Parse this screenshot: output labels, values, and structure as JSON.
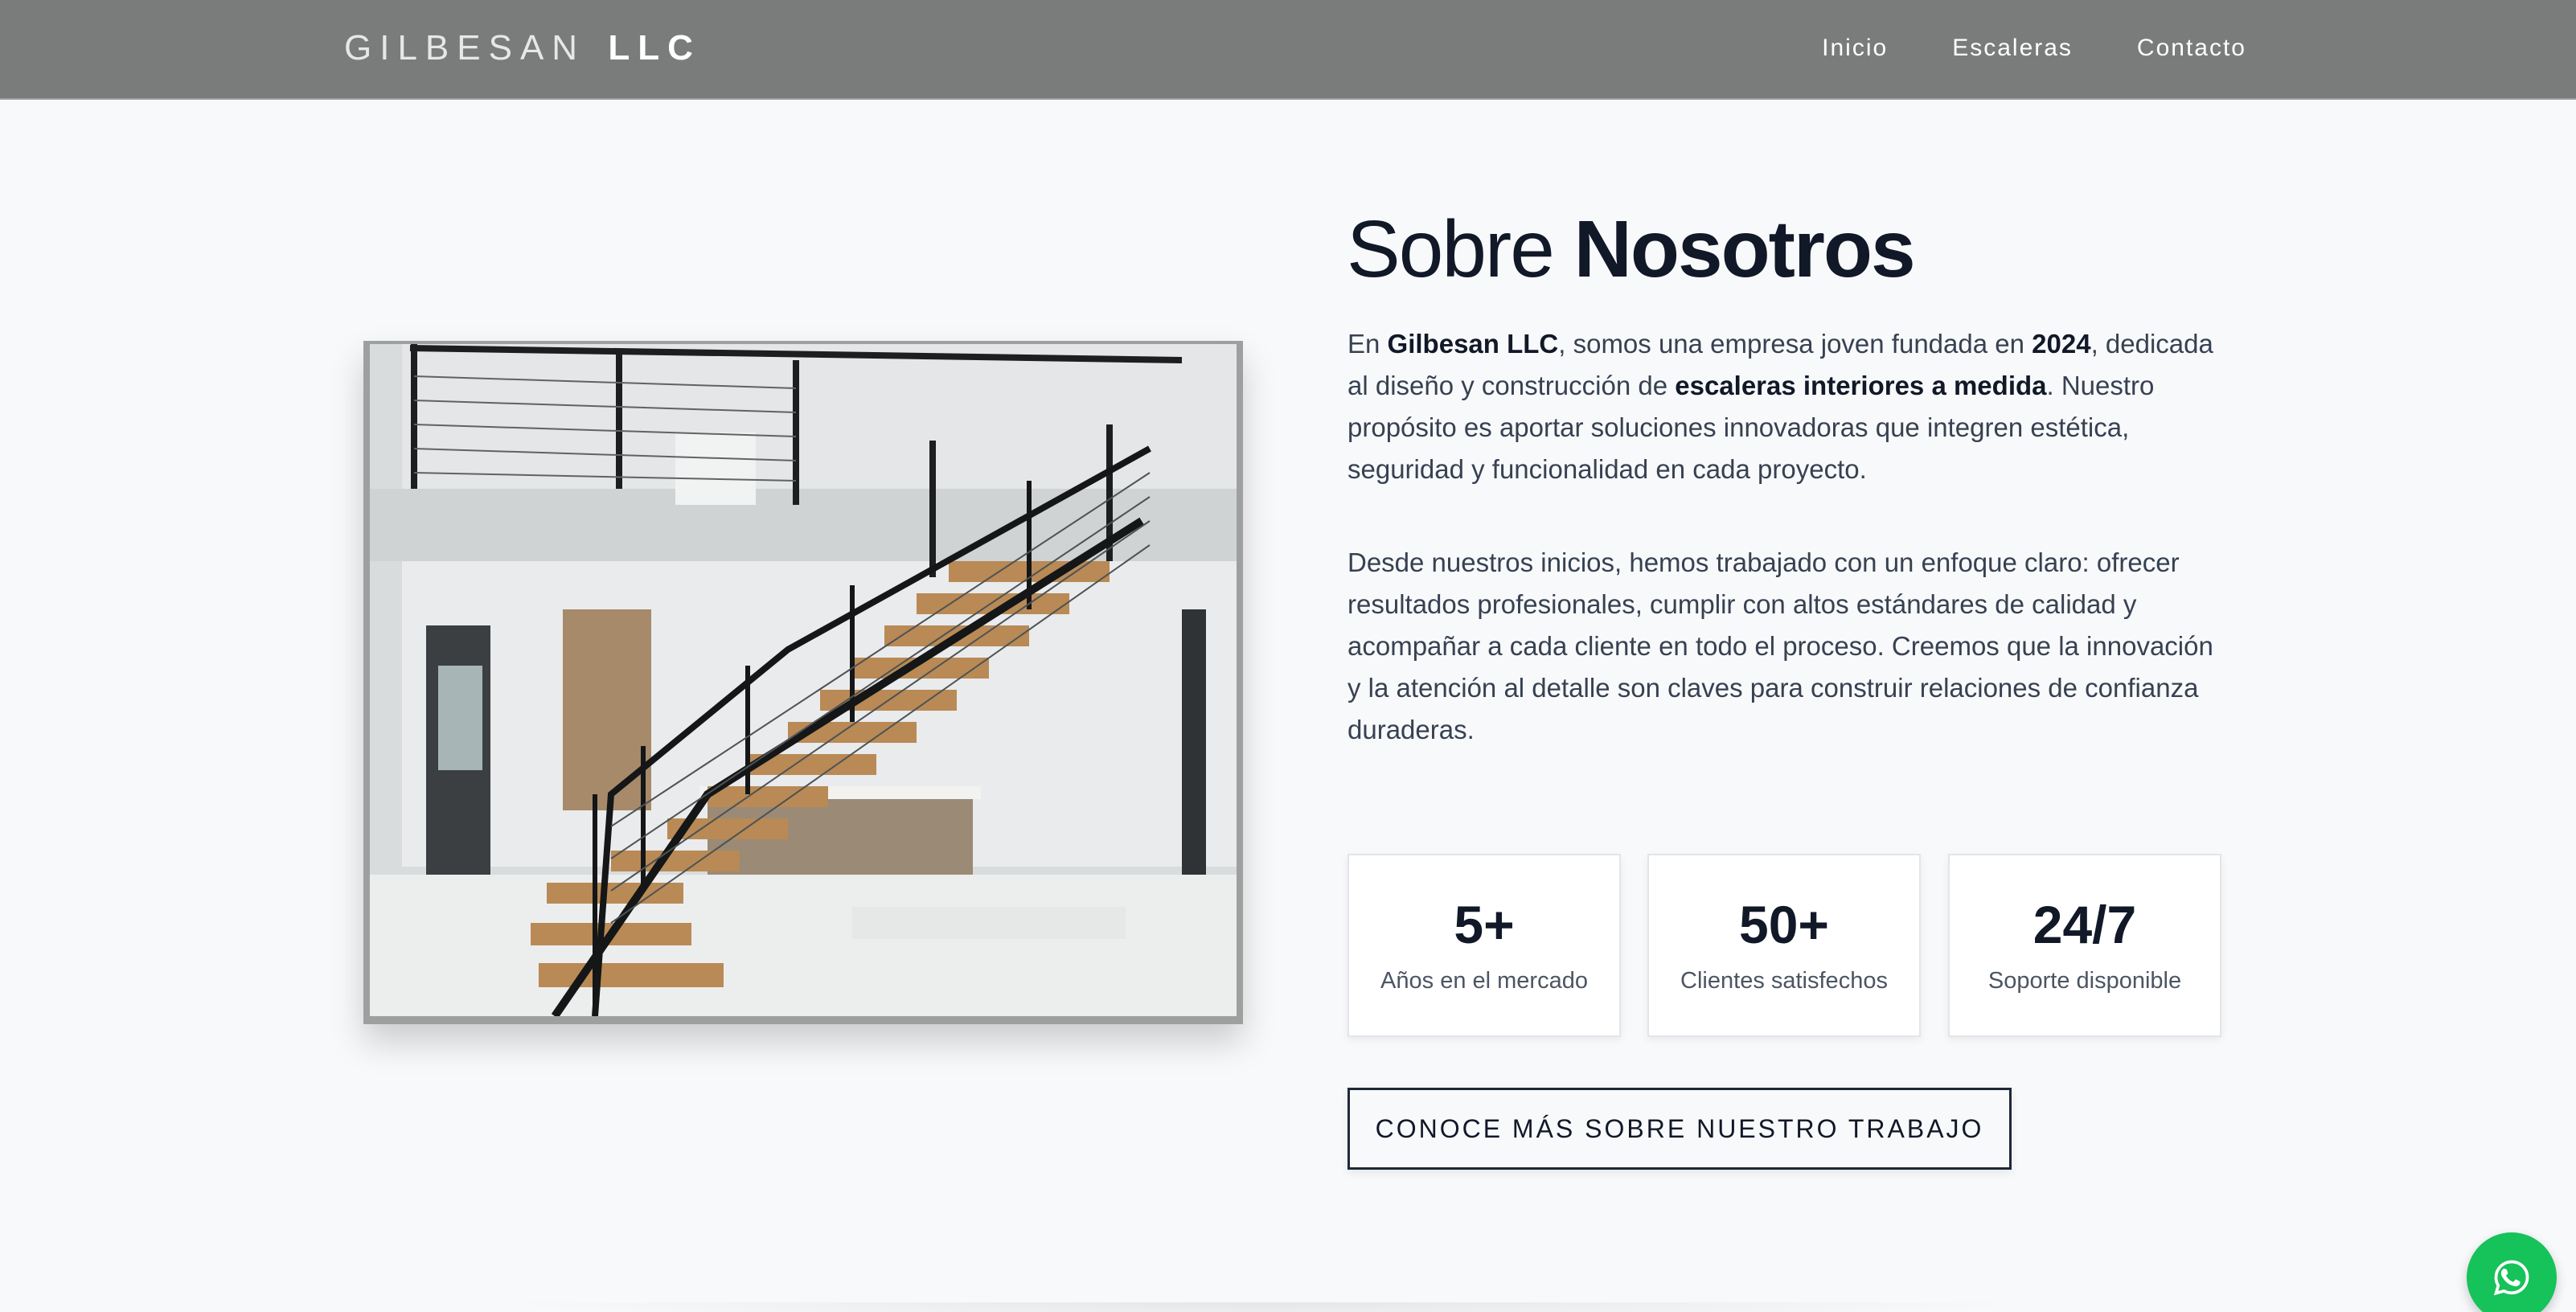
{
  "nav": {
    "brand_light": "GILBESAN",
    "brand_bold": "LLC",
    "links": [
      "Inicio",
      "Escaleras",
      "Contacto"
    ]
  },
  "about": {
    "heading_light": "Sobre",
    "heading_bold": "Nosotros",
    "p1": {
      "t1": "En ",
      "b1": "Gilbesan LLC",
      "t2": ", somos una empresa joven fundada en ",
      "b2": "2024",
      "t3": ", dedicada al diseño y construcción de ",
      "b3": "escaleras interiores a medida",
      "t4": ". Nuestro propósito es aportar soluciones innovadoras que integren estética, seguridad y funcionalidad en cada proyecto."
    },
    "p2": "Desde nuestros inicios, hemos trabajado con un enfoque claro: ofrecer resultados profesionales, cumplir con altos estándares de calidad y acompañar a cada cliente en todo el proceso. Creemos que la innovación y la atención al detalle son claves para construir relaciones de confianza duraderas.",
    "stats": [
      {
        "value": "5+",
        "label": "Años en el mercado"
      },
      {
        "value": "50+",
        "label": "Clientes satisfechos"
      },
      {
        "value": "24/7",
        "label": "Soporte disponible"
      }
    ],
    "cta": "CONOCE MÁS SOBRE NUESTRO TRABAJO"
  },
  "icons": {
    "whatsapp": "whatsapp-icon",
    "photo_content": "floating-staircase-photo"
  },
  "colors": {
    "navbar": "#7a7c7b",
    "whatsapp": "#16c25a",
    "page_bg": "#f8f9fb"
  }
}
